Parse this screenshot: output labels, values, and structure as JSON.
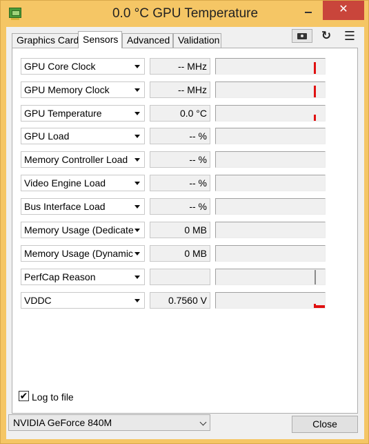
{
  "window": {
    "title": "0.0 °C GPU Temperature",
    "close_glyph": "✕"
  },
  "tabs": [
    {
      "label": "Graphics Card"
    },
    {
      "label": "Sensors",
      "active": true
    },
    {
      "label": "Advanced"
    },
    {
      "label": "Validation"
    }
  ],
  "toolbar": {
    "camera_icon": "camera-icon",
    "refresh_glyph": "↻",
    "menu_glyph": "☰"
  },
  "sensors": [
    {
      "name": "GPU Core Clock",
      "value": "-- MHz"
    },
    {
      "name": "GPU Memory Clock",
      "value": "-- MHz"
    },
    {
      "name": "GPU Temperature",
      "value": "0.0 °C"
    },
    {
      "name": "GPU Load",
      "value": "-- %"
    },
    {
      "name": "Memory Controller Load",
      "value": "-- %"
    },
    {
      "name": "Video Engine Load",
      "value": "-- %"
    },
    {
      "name": "Bus Interface Load",
      "value": "-- %"
    },
    {
      "name": "Memory Usage (Dedicated)",
      "value": "0 MB"
    },
    {
      "name": "Memory Usage (Dynamic)",
      "value": "0 MB"
    },
    {
      "name": "PerfCap Reason",
      "value": ""
    },
    {
      "name": "VDDC",
      "value": "0.7560 V"
    }
  ],
  "log": {
    "label": "Log to file",
    "checked": true,
    "check_glyph": "✔"
  },
  "gpu_select": {
    "value": "NVIDIA GeForce 840M"
  },
  "close_button": {
    "label": "Close"
  },
  "colors": {
    "graph_active": "#e01010",
    "titlebar": "#f5c665",
    "close_red": "#c9453b"
  }
}
